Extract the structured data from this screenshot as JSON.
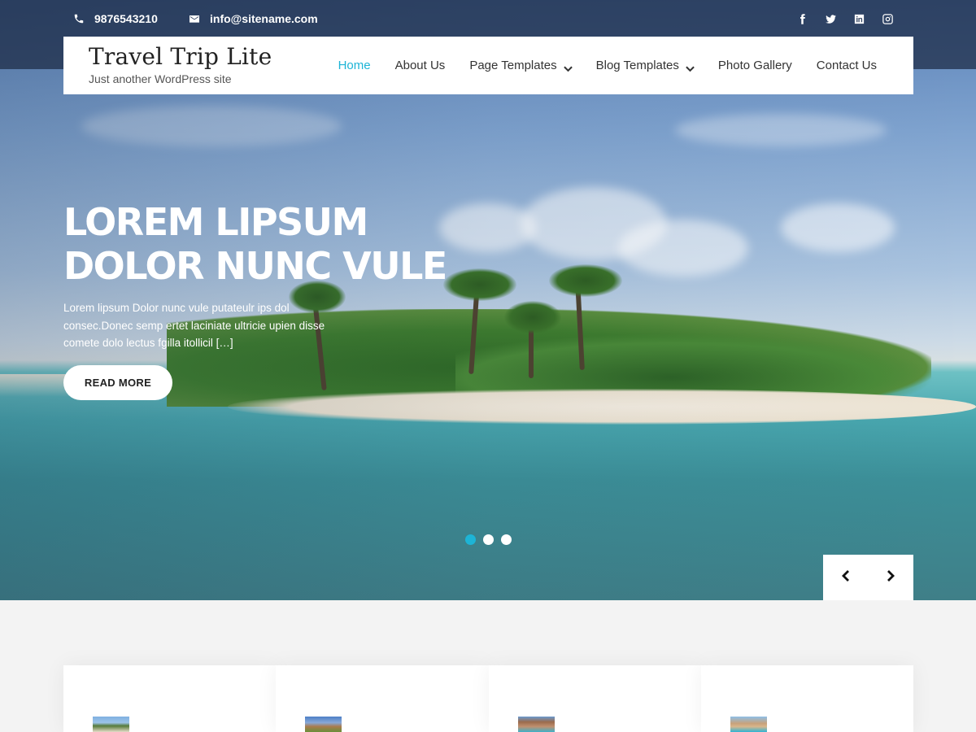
{
  "topbar": {
    "phone": "9876543210",
    "email": "info@sitename.com",
    "social_icons": [
      "facebook-icon",
      "twitter-icon",
      "linkedin-icon",
      "instagram-icon"
    ]
  },
  "site": {
    "title": "Travel Trip Lite",
    "tagline": "Just another WordPress site"
  },
  "nav": {
    "items": [
      {
        "label": "Home",
        "active": true
      },
      {
        "label": "About Us"
      },
      {
        "label": "Page Templates",
        "has_dropdown": true
      },
      {
        "label": "Blog Templates",
        "has_dropdown": true
      },
      {
        "label": "Photo Gallery"
      },
      {
        "label": "Contact Us"
      }
    ]
  },
  "hero": {
    "headline": "LOREM LIPSUM DOLOR NUNC VULE",
    "excerpt": "Lorem lipsum Dolor nunc vule putateulr ips dol consec.Donec semp ertet laciniate ultricie upien disse comete dolo lectus fgilla itollicil […]",
    "read_more": "READ MORE",
    "slides": 3,
    "active_slide": 1
  },
  "colors": {
    "accent": "#1db4d6",
    "text_dark": "#222222"
  }
}
